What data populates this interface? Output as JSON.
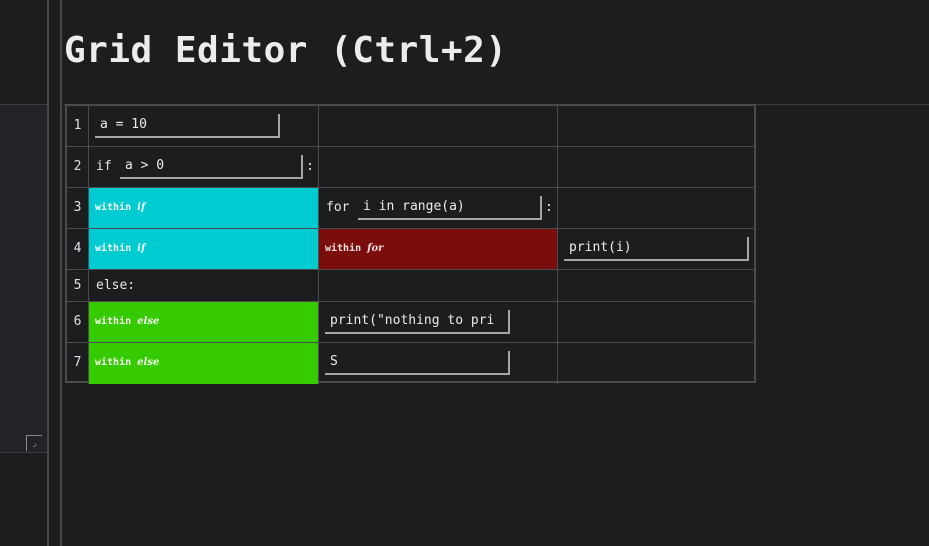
{
  "title": "Grid Editor (Ctrl+2)",
  "left_pane": {
    "resize_grip_glyph": "⌟"
  },
  "grid": {
    "rows": [
      {
        "num": "1",
        "c1_field": "a = 10"
      },
      {
        "num": "2",
        "c1_prefix": "if",
        "c1_field": "a > 0",
        "c1_suffix": ":"
      },
      {
        "num": "3",
        "c1_within": "within",
        "c1_kw": "if",
        "c2_prefix": "for",
        "c2_field": "i in range(a)",
        "c2_suffix": ":"
      },
      {
        "num": "4",
        "c1_within": "within",
        "c1_kw": "if",
        "c2_within": "within",
        "c2_kw": "for",
        "c3_field": "print(i)"
      },
      {
        "num": "5",
        "c1_text": "else:"
      },
      {
        "num": "6",
        "c1_within": "within",
        "c1_kw": "else",
        "c2_field": "print(\"nothing to pri"
      },
      {
        "num": "7",
        "c1_within": "within",
        "c1_kw": "else",
        "c2_field": "S"
      }
    ]
  },
  "colors": {
    "block_if": "#00cbd0",
    "block_for": "#7b0d0d",
    "block_else": "#35cb00",
    "background": "#1c1d1f"
  }
}
